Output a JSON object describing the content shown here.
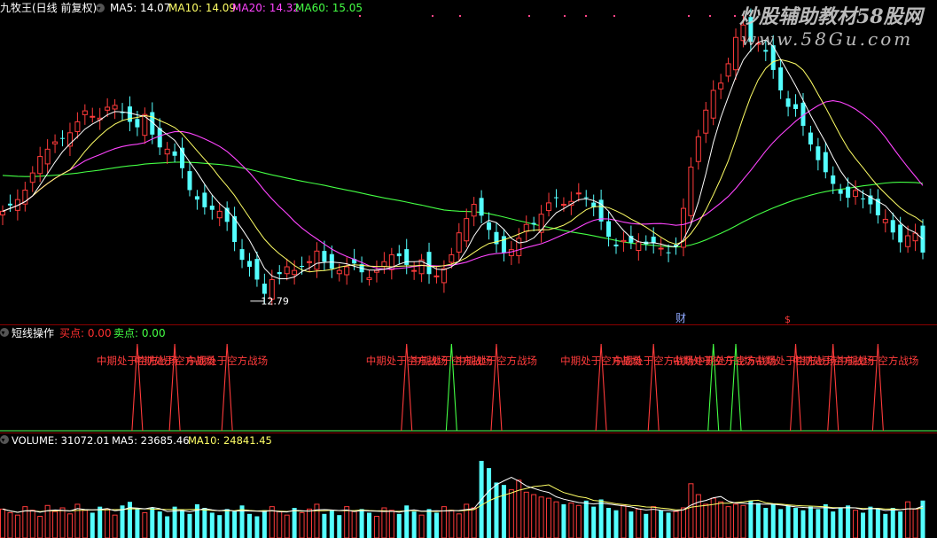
{
  "header": {
    "main": {
      "title": "九牧王(日线 前复权)",
      "items": [
        {
          "label": "MA5: 14.07",
          "color": "#ffffff"
        },
        {
          "label": "MA10: 14.09",
          "color": "#ffff66"
        },
        {
          "label": "MA20: 14.32",
          "color": "#ff44ff"
        },
        {
          "label": "MA60: 15.05",
          "color": "#44ff44"
        }
      ]
    },
    "signal": {
      "title": "短线操作",
      "items": [
        {
          "label": "买点: 0.00",
          "color": "#ff3030"
        },
        {
          "label": "卖点: 0.00",
          "color": "#44ff44"
        }
      ]
    },
    "volume": {
      "items": [
        {
          "label": "VOLUME: 31072.01",
          "color": "#ffffff"
        },
        {
          "label": "MA5: 23685.46",
          "color": "#ffffff"
        },
        {
          "label": "MA10: 24841.45",
          "color": "#ffff66"
        }
      ]
    }
  },
  "annotations": {
    "low_price": "12.79",
    "cai_marker": "财",
    "s_marker": "$"
  },
  "watermark": {
    "line1": "炒股辅助教材58股网",
    "line2": "www.58Gu.com"
  },
  "colors": {
    "up": "#ff3b3b",
    "down": "#54ffff",
    "ma5": "#ffffff",
    "ma10": "#ffff66",
    "ma20": "#ff44ff",
    "ma60": "#44ff44",
    "grid": "#8b0000"
  },
  "chart_data": [
    {
      "type": "candlestick",
      "series": [
        {
          "name": "MA5",
          "value": 14.07
        },
        {
          "name": "MA10",
          "value": 14.09
        },
        {
          "name": "MA20",
          "value": 14.32
        },
        {
          "name": "MA60",
          "value": 15.05
        }
      ],
      "close": [
        15.2,
        15.36,
        15.52,
        15.78,
        16.25,
        16.7,
        16.9,
        17.1,
        17.2,
        17.35,
        17.65,
        17.95,
        17.8,
        17.75,
        18.05,
        18.1,
        17.9,
        17.65,
        17.5,
        17.85,
        17.3,
        16.95,
        16.9,
        16.72,
        16.38,
        15.78,
        15.52,
        15.31,
        15.24,
        15.2,
        14.91,
        14.36,
        13.87,
        13.68,
        13.33,
        12.94,
        13.33,
        13.48,
        13.68,
        13.58,
        13.68,
        13.82,
        14.11,
        13.82,
        13.63,
        13.58,
        13.68,
        13.77,
        13.53,
        13.38,
        13.58,
        13.82,
        14.01,
        13.97,
        13.73,
        13.58,
        13.87,
        13.48,
        13.43,
        13.63,
        14.01,
        14.61,
        15.0,
        15.39,
        15.08,
        14.69,
        14.3,
        14.07,
        14.15,
        14.46,
        14.84,
        14.84,
        15.12,
        15.43,
        15.58,
        15.39,
        15.47,
        15.7,
        15.58,
        15.31,
        14.92,
        14.5,
        14.24,
        14.4,
        14.34,
        14.36,
        14.3,
        14.32,
        14.19,
        14.07,
        14.24,
        15.28,
        16.41,
        17.24,
        17.97,
        18.51,
        18.71,
        19.24,
        19.96,
        20.3,
        19.84,
        19.8,
        19.57,
        19.07,
        18.51,
        18.06,
        18.0,
        17.54,
        17.03,
        16.6,
        16.27,
        15.95,
        15.68,
        15.57,
        15.77,
        15.53,
        15.39,
        15.09,
        14.98,
        14.62,
        14.35,
        14.53,
        14.6,
        14.07
      ],
      "ylim": [
        12.2,
        20.5
      ],
      "low_annotation": 12.79
    },
    {
      "type": "bar",
      "title": "短线操作",
      "series": [
        {
          "name": "买点",
          "value": 0.0
        },
        {
          "name": "卖点",
          "value": 0.0
        }
      ],
      "signals": [
        {
          "bar": 18,
          "type": "buy",
          "label": "中期处于空方战场"
        },
        {
          "bar": 23,
          "type": "buy",
          "label": "中期处于空方战场"
        },
        {
          "bar": 30,
          "type": "buy",
          "label": "中期处于空方战场"
        },
        {
          "bar": 54,
          "type": "buy",
          "label": "中期处于空方战场"
        },
        {
          "bar": 60,
          "type": "sell",
          "label": "中期处于空方战场"
        },
        {
          "bar": 66,
          "type": "buy",
          "label": "中期处于空方战场"
        },
        {
          "bar": 80,
          "type": "buy",
          "label": "中期处于空方战场"
        },
        {
          "bar": 87,
          "type": "buy",
          "label": "中期处于空方战场"
        },
        {
          "bar": 95,
          "type": "sell",
          "label": "中期处于空方战场"
        },
        {
          "bar": 98,
          "type": "sell",
          "label": "中期处于空方战场"
        },
        {
          "bar": 106,
          "type": "buy",
          "label": "中期处于空方战场"
        },
        {
          "bar": 111,
          "type": "buy",
          "label": "中期处于空方战场"
        },
        {
          "bar": 117,
          "type": "buy",
          "label": "中期处于空方战场"
        }
      ]
    },
    {
      "type": "bar",
      "title": "VOLUME",
      "series": [
        {
          "name": "VOLUME",
          "value": 31072.01
        },
        {
          "name": "MA5",
          "value": 23685.46
        },
        {
          "name": "MA10",
          "value": 24841.45
        }
      ],
      "volume": [
        24000,
        21000,
        19000,
        26000,
        23000,
        18000,
        27000,
        22000,
        25000,
        20000,
        28000,
        23000,
        21000,
        26000,
        24000,
        19000,
        27000,
        30000,
        24000,
        21000,
        25000,
        22000,
        18000,
        26000,
        23000,
        20000,
        28000,
        25000,
        21000,
        19000,
        24000,
        22000,
        27000,
        20000,
        18000,
        23000,
        26000,
        22000,
        19000,
        25000,
        21000,
        24000,
        28000,
        20000,
        23000,
        19000,
        26000,
        22000,
        24000,
        21000,
        18000,
        25000,
        23000,
        20000,
        27000,
        22000,
        19000,
        24000,
        21000,
        26000,
        23000,
        20000,
        28000,
        25000,
        64000,
        58000,
        46000,
        44000,
        40000,
        48000,
        38000,
        36000,
        34000,
        33000,
        30000,
        28000,
        29000,
        27000,
        31000,
        26000,
        32000,
        25000,
        23000,
        27000,
        22000,
        24000,
        20000,
        26000,
        23000,
        21000,
        22000,
        25000,
        45000,
        36000,
        28000,
        33000,
        30000,
        26000,
        28000,
        27000,
        31000,
        29000,
        25000,
        28000,
        24000,
        27000,
        25000,
        23000,
        26000,
        24000,
        28000,
        22000,
        25000,
        27000,
        23000,
        21000,
        26000,
        24000,
        20000,
        25000,
        22000,
        30000,
        24000,
        31072.01
      ],
      "ylim": [
        0,
        75000
      ]
    }
  ]
}
